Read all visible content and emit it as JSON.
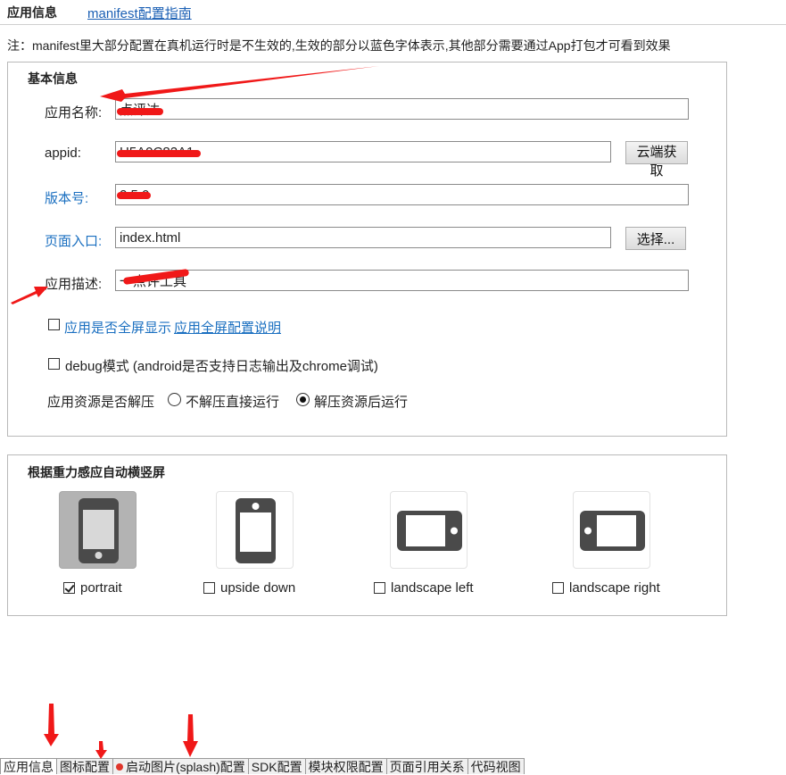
{
  "header": {
    "title": "应用信息",
    "guide_link": "manifest配置指南"
  },
  "note": "注：manifest里大部分配置在真机运行时是不生效的,生效的部分以蓝色字体表示,其他部分需要通过App打包才可看到效果",
  "basic_info": {
    "title": "基本信息",
    "fields": {
      "app_name": {
        "label": "应用名称:",
        "value": "点评达"
      },
      "appid": {
        "label": "appid:",
        "value": "H5A0C82A1"
      },
      "version": {
        "label": "版本号:",
        "value": "2.5.0"
      },
      "entry": {
        "label": "页面入口:",
        "value": "index.html"
      },
      "description": {
        "label": "应用描述:",
        "value": "一点评工具"
      }
    },
    "buttons": {
      "cloud_fetch": "云端获取",
      "choose": "选择..."
    },
    "fullscreen": {
      "label": "应用是否全屏显示",
      "help_link": "应用全屏配置说明",
      "checked": false
    },
    "debug": {
      "label": "debug模式 (android是否支持日志输出及chrome调试)",
      "checked": false
    },
    "unpack": {
      "label": "应用资源是否解压",
      "options": [
        "不解压直接运行",
        "解压资源后运行"
      ],
      "selected": "解压资源后运行"
    }
  },
  "orientation": {
    "title": "根据重力感应自动横竖屏",
    "options": [
      {
        "label": "portrait",
        "checked": true,
        "icon": "phone-portrait-icon"
      },
      {
        "label": "upside down",
        "checked": false,
        "icon": "phone-upside-down-icon"
      },
      {
        "label": "landscape left",
        "checked": false,
        "icon": "phone-landscape-left-icon"
      },
      {
        "label": "landscape right",
        "checked": false,
        "icon": "phone-landscape-right-icon"
      }
    ]
  },
  "tabs": [
    {
      "label": "应用信息",
      "active": true,
      "error": false
    },
    {
      "label": "图标配置",
      "active": false,
      "error": false
    },
    {
      "label": "启动图片(splash)配置",
      "active": false,
      "error": true
    },
    {
      "label": "SDK配置",
      "active": false,
      "error": false
    },
    {
      "label": "模块权限配置",
      "active": false,
      "error": false
    },
    {
      "label": "页面引用关系",
      "active": false,
      "error": false
    },
    {
      "label": "代码视图",
      "active": false,
      "error": false
    }
  ],
  "colors": {
    "link_blue": "#1a6fc0",
    "annotation_red": "#f01818",
    "selected_tile": "#b3b3b3"
  }
}
